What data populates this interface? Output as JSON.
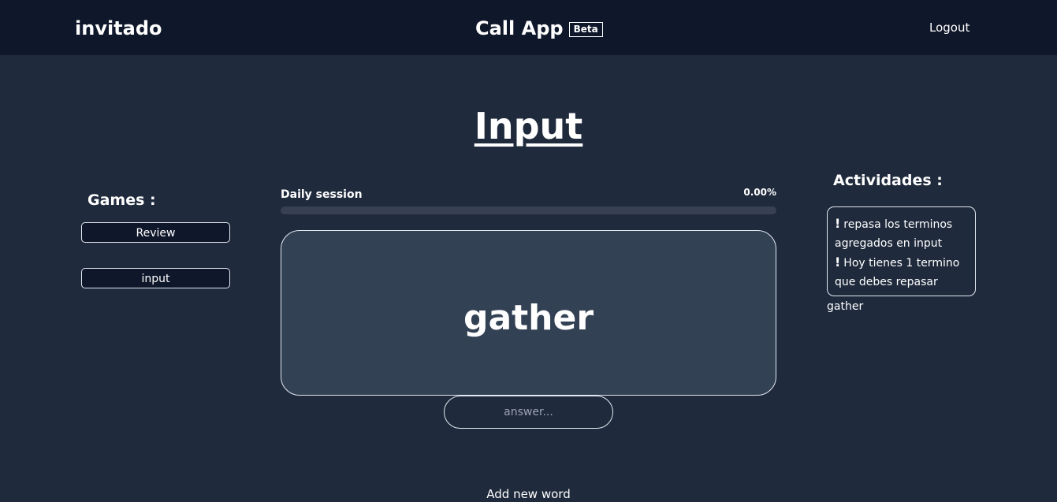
{
  "header": {
    "username": "invitado",
    "app_title": "Call App",
    "badge": "Beta",
    "logout_label": "Logout"
  },
  "main": {
    "title": "Input",
    "session_label": "Daily session",
    "session_percent_text": "0.00%",
    "session_progress_fraction": 0.0,
    "card_word": "gather",
    "answer_placeholder": "answer...",
    "add_word_label": "Add new word"
  },
  "games": {
    "label": "Games :",
    "items": [
      {
        "label": "Review"
      },
      {
        "label": "input"
      }
    ]
  },
  "activities": {
    "label": "Actividades :",
    "items": [
      {
        "icon": "!",
        "text": "repasa los terminos agregados en input"
      },
      {
        "icon": "!",
        "text": "Hoy tienes 1 termino que debes repasar"
      }
    ],
    "pending_word": "gather"
  },
  "colors": {
    "background": "#1f2a3c",
    "topbar": "#0f172a",
    "card": "#334155",
    "progress_track": "#374151"
  }
}
